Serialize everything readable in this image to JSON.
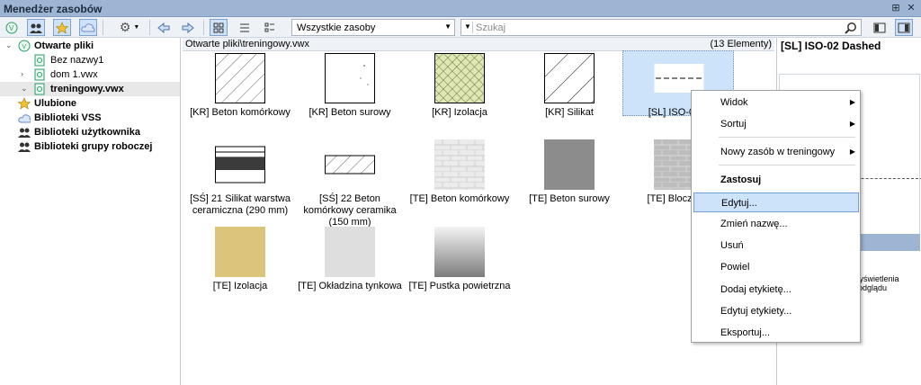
{
  "window": {
    "title": "Menedżer zasobów"
  },
  "toolbar": {
    "filter_value": "Wszystkie zasoby",
    "search_placeholder": "Szukaj"
  },
  "tree": {
    "open_files": "Otwarte pliki",
    "files": [
      "Bez nazwy1",
      "dom 1.vwx",
      "treningowy.vwx"
    ],
    "favorites": "Ulubione",
    "vss": "Biblioteki VSS",
    "user_libs": "Biblioteki użytkownika",
    "group_libs": "Biblioteki grupy roboczej"
  },
  "browser": {
    "path": "Otwarte pliki\\treningowy.vwx",
    "count": "(13 Elementy)",
    "items": [
      {
        "caption": "[KR] Beton komórkowy"
      },
      {
        "caption": "[KR] Beton surowy"
      },
      {
        "caption": "[KR] Izolacja"
      },
      {
        "caption": "[KR] Silikat"
      },
      {
        "caption": "[SL] ISO-02 D"
      },
      {
        "caption": "[SŚ] 21 Silikat warstwa ceramiczna (290 mm)"
      },
      {
        "caption": "[SŚ] 22 Beton komórkowy ceramika (150 mm)"
      },
      {
        "caption": "[TE] Beton komórkowy"
      },
      {
        "caption": "[TE] Beton surowy"
      },
      {
        "caption": "[TE] Bloczek b"
      },
      {
        "caption": "[TE] Izolacja"
      },
      {
        "caption": "[TE] Okładzina tynkowa"
      },
      {
        "caption": "[TE] Pustka powietrzna"
      }
    ]
  },
  "preview": {
    "title": "[SL] ISO-02 Dashed",
    "note": "wyświetlenia podglądu"
  },
  "context_menu": {
    "view": "Widok",
    "sort": "Sortuj",
    "new_resource": "Nowy zasób w treningowy",
    "apply": "Zastosuj",
    "edit": "Edytuj...",
    "rename": "Zmień nazwę...",
    "delete": "Usuń",
    "duplicate": "Powiel",
    "add_tag": "Dodaj etykietę...",
    "edit_tags": "Edytuj etykiety...",
    "export": "Eksportuj..."
  }
}
